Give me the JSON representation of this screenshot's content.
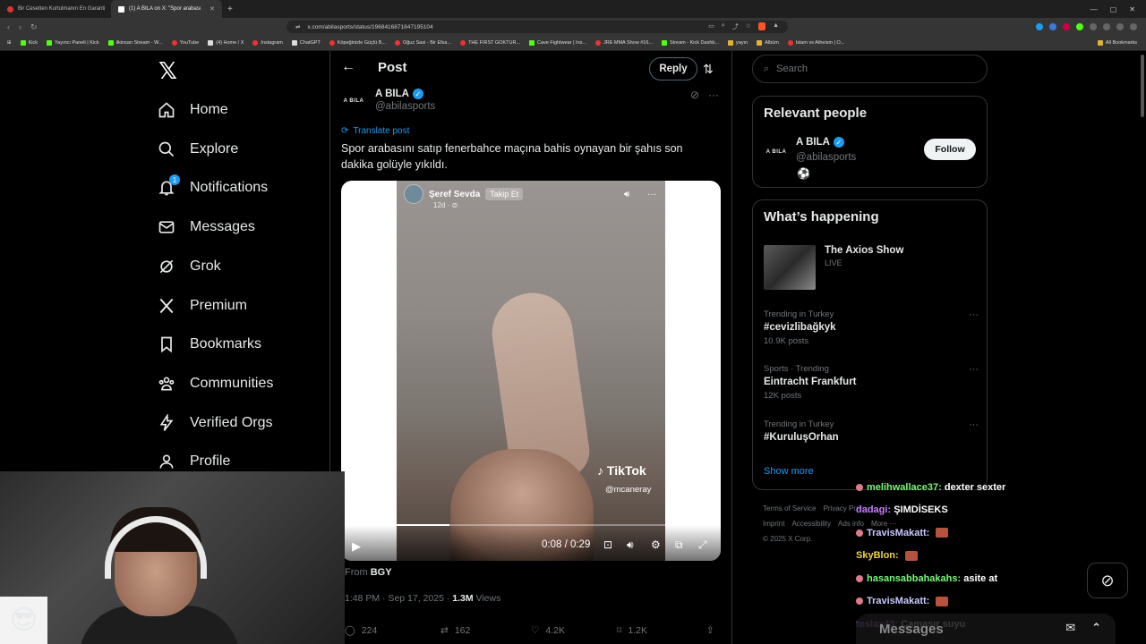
{
  "browser": {
    "tabs": [
      {
        "title": "Bir Cesetten Kurtulmanın En Garanti"
      },
      {
        "title": "(1) A BILA on X: \"Spor arabası"
      }
    ],
    "url": "x.com/abilasports/status/1968416871847195104",
    "bookmarks": [
      "Kick",
      "Yayıncı Paneli | Kick",
      "ilkinsan Stream - W...",
      "YouTube",
      "(4) Home / X",
      "Instagram",
      "ChatGPT",
      "Köpeğinizle Güçlü B...",
      "Oğuz Sasi - Bir Efsa...",
      "THE FIRST GOKTUR...",
      "Cave Fightwear | Ins...",
      "JRE MMA Show #16...",
      "Stream - Kick Dashb...",
      "yayın",
      "Albüm",
      "Islam vs Atheism | O..."
    ],
    "all_bookmarks": "All Bookmarks"
  },
  "nav": {
    "items": [
      {
        "label": "Home"
      },
      {
        "label": "Explore"
      },
      {
        "label": "Notifications",
        "badge": "1"
      },
      {
        "label": "Messages"
      },
      {
        "label": "Grok"
      },
      {
        "label": "Premium"
      },
      {
        "label": "Bookmarks"
      },
      {
        "label": "Communities"
      },
      {
        "label": "Verified Orgs"
      },
      {
        "label": "Profile"
      }
    ]
  },
  "post": {
    "header_title": "Post",
    "reply_label": "Reply",
    "author_name": "A BILA",
    "author_handle": "@abilasports",
    "avatar_text": "A BILA",
    "translate_label": "Translate post",
    "text": "Spor arabasını satıp fenerbahce maçına bahis oynayan bir şahıs son dakika golüyle yıkıldı.",
    "video": {
      "tiktok_user": "Şeref Sevda",
      "tiktok_follow": "Takip Et",
      "tiktok_age": "12d · ⊜",
      "tiktok_logo": "TikTok",
      "tiktok_handle": "@mcaneray",
      "time": "0:08 / 0:29",
      "progress": 0.28
    },
    "from_label": "From",
    "from_source": "BGY",
    "timestamp": "1:48 PM · Sep 17, 2025 ·",
    "views": "1.3M",
    "views_label": "Views",
    "actions": {
      "replies": "224",
      "reposts": "162",
      "likes": "4.2K",
      "bookmarks": "1.2K"
    }
  },
  "sidebar": {
    "search_placeholder": "Search",
    "relevant_title": "Relevant people",
    "relevant_name": "A BILA",
    "relevant_handle": "@abilasports",
    "relevant_bio": "⚽",
    "follow_label": "Follow",
    "whats_title": "What’s happening",
    "live_title": "The Axios Show",
    "live_label": "LIVE",
    "trends": [
      {
        "category": "Trending in Turkey",
        "title": "#cevizlibağkyk",
        "count": "10.9K posts"
      },
      {
        "category": "Sports · Trending",
        "title": "Eintracht Frankfurt",
        "count": "12K posts"
      },
      {
        "category": "Trending in Turkey",
        "title": "#KuruluşOrhan",
        "count": ""
      }
    ],
    "show_more": "Show more",
    "footer": [
      "Terms of Service",
      "Privacy Policy",
      "Imprint",
      "Accessibility",
      "Ads info",
      "More ···",
      "© 2025 X Corp."
    ]
  },
  "chat": {
    "messages": [
      {
        "user": "melihwallace37:",
        "text": "dexter sexter",
        "color": "#7cf67a",
        "badge": true,
        "emote": false
      },
      {
        "user": "dadagi:",
        "text": "ŞIMDİSEKS",
        "color": "#c77dff",
        "badge": false,
        "emote": false
      },
      {
        "user": "TravisMakatt:",
        "text": "",
        "color": "#c8c8ff",
        "badge": true,
        "emote": true
      },
      {
        "user": "SkyBlon:",
        "text": "",
        "color": "#f0d34a",
        "badge": false,
        "emote": true
      },
      {
        "user": "hasansabbahakahs:",
        "text": "asite at",
        "color": "#7cf67a",
        "badge": true,
        "emote": false
      },
      {
        "user": "TravisMakatt:",
        "text": "",
        "color": "#c8c8ff",
        "badge": true,
        "emote": true
      },
      {
        "user": "teslax43:",
        "text": "Çamaşır suyu",
        "color": "#c77dff",
        "badge": false,
        "emote": false
      }
    ],
    "messages_bar": "Messages"
  },
  "colors": {
    "accent": "#1d9bf0",
    "bg": "#000000",
    "muted": "#71767b"
  }
}
